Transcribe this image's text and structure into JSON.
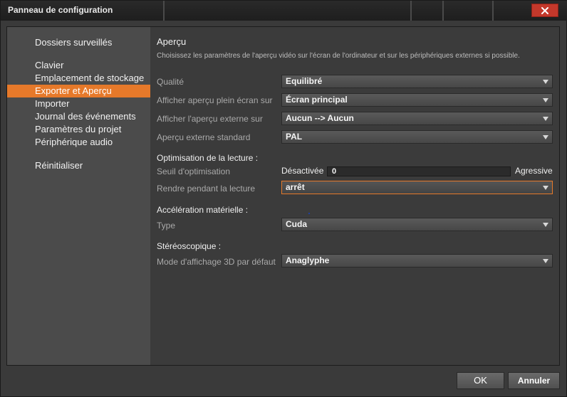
{
  "window": {
    "title": "Panneau de configuration",
    "accent_color": "#e6792a",
    "close_color": "#c3382b"
  },
  "sidebar": {
    "items": [
      {
        "label": "Dossiers surveillés",
        "active": false
      },
      {
        "label": "Clavier",
        "active": false
      },
      {
        "label": "Emplacement de stockage",
        "active": false
      },
      {
        "label": "Exporter et Aperçu",
        "active": true
      },
      {
        "label": "Importer",
        "active": false
      },
      {
        "label": "Journal des événements",
        "active": false
      },
      {
        "label": "Paramètres du projet",
        "active": false
      },
      {
        "label": "Périphérique audio",
        "active": false
      },
      {
        "label": "Réinitialiser",
        "active": false
      }
    ]
  },
  "content": {
    "section_title": "Aperçu",
    "description": "Choisissez les paramètres de l'aperçu vidéo sur l'écran de l'ordinateur et sur les périphériques externes si possible.",
    "rows": {
      "qualite": {
        "label": "Qualité",
        "value": "Equilibré"
      },
      "plein_ecran": {
        "label": "Afficher aperçu plein écran sur",
        "value": "Écran principal"
      },
      "externe": {
        "label": "Afficher l'aperçu externe sur",
        "value": "Aucun --> Aucun"
      },
      "standard": {
        "label": "Aperçu externe standard",
        "value": "PAL"
      }
    },
    "optimisation": {
      "heading": "Optimisation de la lecture :",
      "seuil_label": "Seuil d'optimisation",
      "slider_min": "Désactivée",
      "slider_value": "0",
      "slider_max": "Agressive",
      "rendre_label": "Rendre pendant la lecture",
      "rendre_value": "arrêt"
    },
    "acceleration": {
      "heading": "Accélération matérielle :",
      "type_label": "Type",
      "type_value": "Cuda"
    },
    "stereo": {
      "heading": "Stéréoscopique :",
      "mode_label": "Mode d'affichage 3D par défaut",
      "mode_value": "Anaglyphe"
    }
  },
  "footer": {
    "ok_label": "OK",
    "cancel_label": "Annuler"
  }
}
